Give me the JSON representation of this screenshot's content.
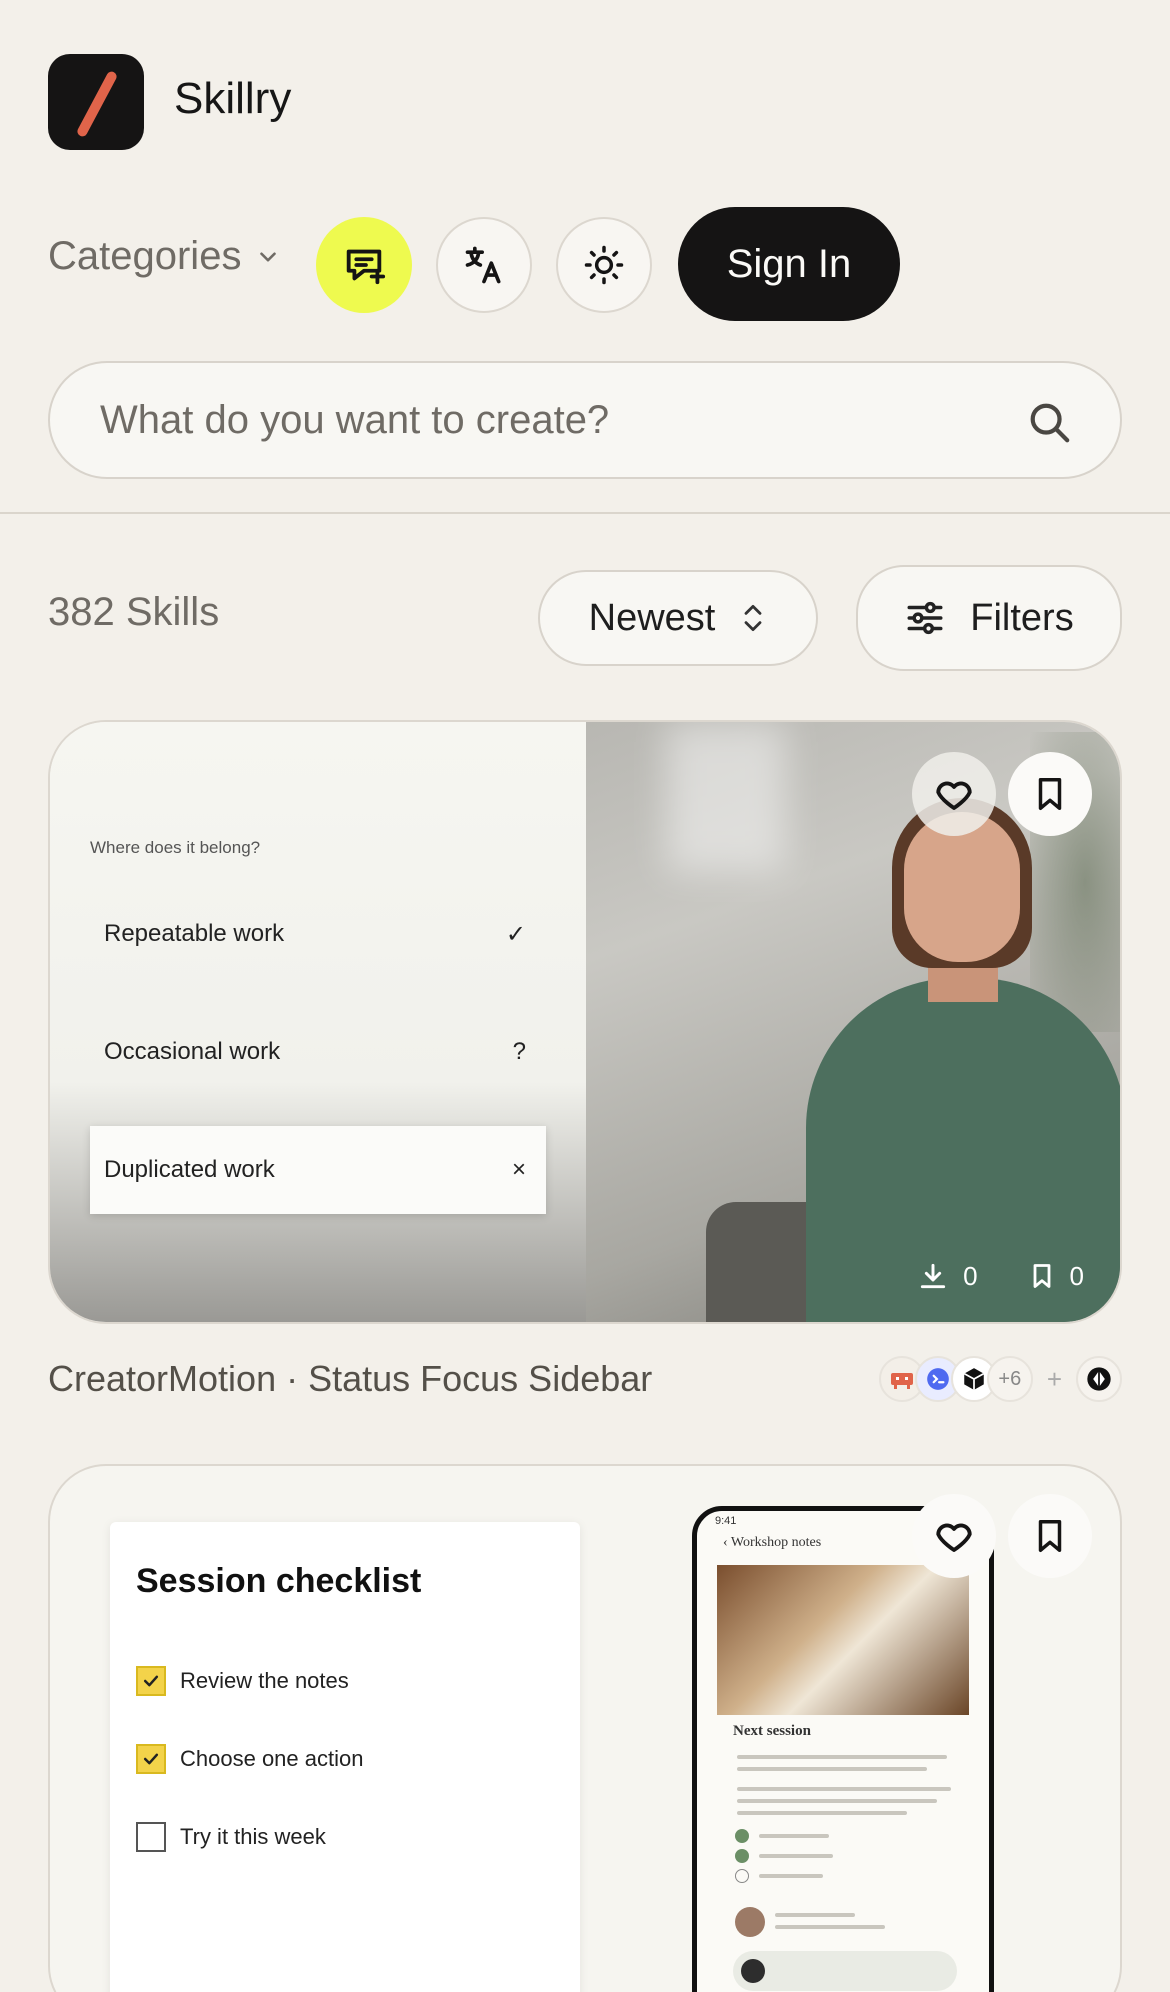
{
  "app": {
    "name": "Skillry"
  },
  "nav": {
    "categories_label": "Categories",
    "signin_label": "Sign In"
  },
  "search": {
    "placeholder": "What do you want to create?",
    "value": ""
  },
  "toolbar": {
    "skills_count": "382 Skills",
    "sort_label": "Newest",
    "filters_label": "Filters"
  },
  "cards": [
    {
      "title": "CreatorMotion · Status Focus Sidebar",
      "downloads": "0",
      "saves": "0",
      "preview": {
        "question": "Where does it belong?",
        "choices": [
          {
            "label": "Repeatable work",
            "mark": "✓"
          },
          {
            "label": "Occasional work",
            "mark": "?"
          },
          {
            "label": "Duplicated work",
            "mark": "×"
          }
        ]
      },
      "more_agents": "+6",
      "agent_icons": [
        "robot-icon",
        "terminal-icon",
        "cube-icon"
      ]
    },
    {
      "preview": {
        "checklist_title": "Session checklist",
        "items": [
          {
            "label": "Review the notes",
            "checked": true
          },
          {
            "label": "Choose one action",
            "checked": true
          },
          {
            "label": "Try it this week",
            "checked": false
          }
        ],
        "phone_time": "9:41",
        "phone_header": "Workshop notes",
        "phone_section": "Next session"
      }
    }
  ],
  "colors": {
    "background": "#f3f0ea",
    "accent_yellow": "#eefa4f",
    "logo_stroke": "#e0644a",
    "dark": "#151414"
  }
}
